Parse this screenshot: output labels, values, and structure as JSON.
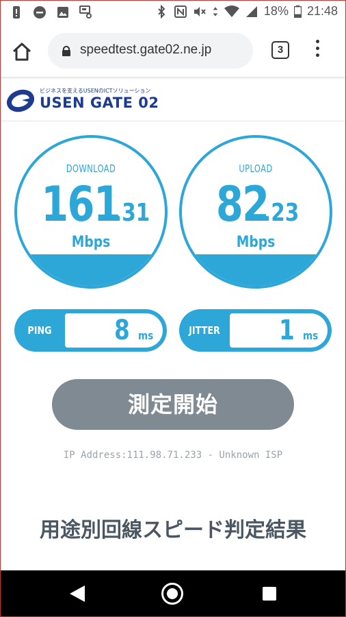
{
  "status_bar": {
    "battery_percent": "18%",
    "time": "21:48",
    "icons": [
      "alert-icon",
      "do-not-disturb-icon",
      "image-icon",
      "nfc-card-icon",
      "bluetooth-icon",
      "nfc-icon",
      "mute-icon",
      "data-arrows-icon",
      "wifi-icon",
      "signal-icon",
      "battery-icon"
    ]
  },
  "browser": {
    "url": "speedtest.gate02.ne.jp",
    "tab_count": "3"
  },
  "header": {
    "logo_tagline": "ビジネスを支えるUSENのICTソリューション",
    "logo_name": "USEN GATE 02"
  },
  "download": {
    "label": "DOWNLOAD",
    "value_int": "161",
    "value_dec": ".31",
    "unit": "Mbps"
  },
  "upload": {
    "label": "UPLOAD",
    "value_int": "82",
    "value_dec": ".23",
    "unit": "Mbps"
  },
  "ping": {
    "label": "PING",
    "value": "8",
    "unit": "ms"
  },
  "jitter": {
    "label": "JITTER",
    "value": "1",
    "unit": "ms"
  },
  "start_button_label": "測定開始",
  "ip_info": "IP Address:111.98.71.233 - Unknown ISP",
  "section_title": "用途別回線スピード判定結果",
  "colors": {
    "accent": "#2ca7d8",
    "button_gray": "#7f8a93",
    "logo_blue": "#1d3c8f"
  }
}
